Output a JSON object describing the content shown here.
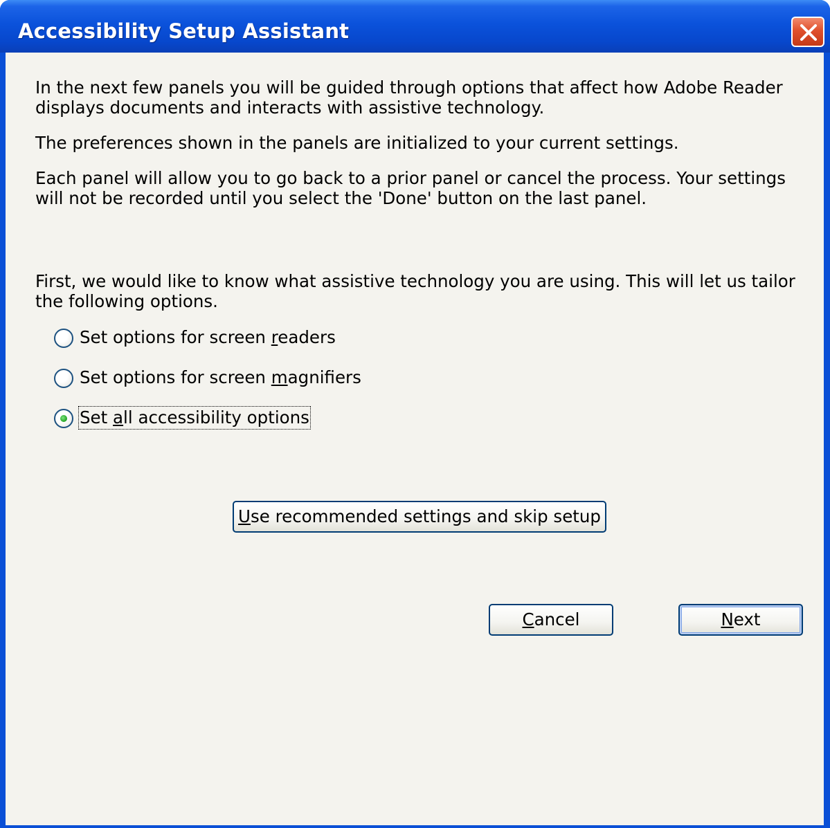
{
  "window": {
    "title": "Accessibility Setup Assistant"
  },
  "intro": {
    "p1": "In the next few panels you will be guided through options that affect how Adobe Reader displays documents and interacts with assistive technology.",
    "p2": "The preferences shown in the panels are initialized to your current settings.",
    "p3": "Each panel will allow you to go back to a prior panel or cancel the process. Your settings will not be recorded until you select the 'Done' button on the last panel.",
    "p4": "First, we would like to know what assistive technology you are using. This will let us tailor the following options."
  },
  "options": [
    {
      "label_pre": "Set options for screen ",
      "label_key": "r",
      "label_post": "eaders",
      "selected": false
    },
    {
      "label_pre": "Set options for screen ",
      "label_key": "m",
      "label_post": "agnifiers",
      "selected": false
    },
    {
      "label_pre": "Set ",
      "label_key": "a",
      "label_post": "ll accessibility options",
      "selected": true
    }
  ],
  "buttons": {
    "skip_key": "U",
    "skip_rest": "se recommended settings and skip setup",
    "cancel_key": "C",
    "cancel_rest": "ancel",
    "next_key": "N",
    "next_rest": "ext"
  },
  "icons": {
    "close": "close-x-icon",
    "radio_selected_color": "#21a121"
  }
}
